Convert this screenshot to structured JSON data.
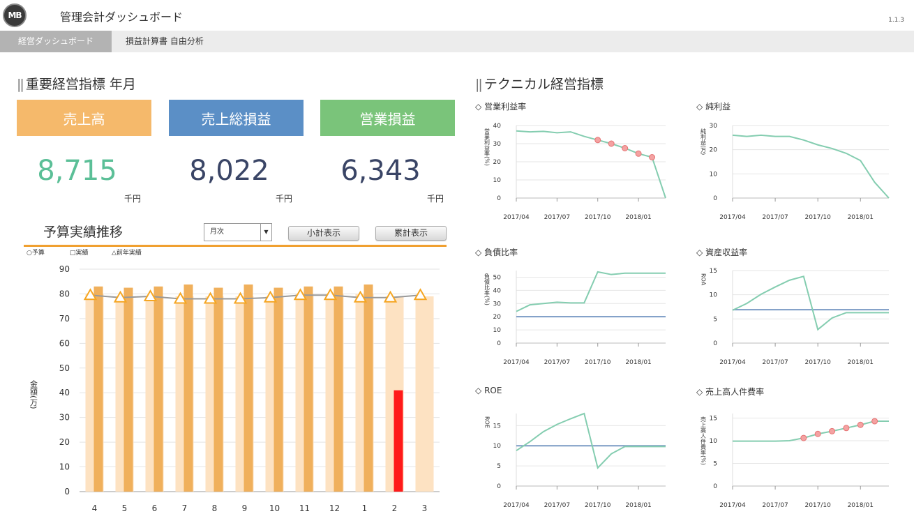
{
  "header": {
    "logo_text": "MB",
    "title": "管理会計ダッシュボード",
    "version": "1.1.3"
  },
  "nav": {
    "tabs": [
      {
        "label": "経営ダッシュボード",
        "active": true
      },
      {
        "label": "損益計算書 自由分析",
        "active": false
      }
    ]
  },
  "kpi_section": {
    "title": "重要経営指標 年月",
    "cards": [
      {
        "label": "売上高",
        "value": "8,715",
        "unit": "千円",
        "color": "#f5b96b",
        "value_color": "#5bbf97"
      },
      {
        "label": "売上総損益",
        "value": "8,022",
        "unit": "千円",
        "color": "#5b8fc6",
        "value_color": "#3a4566"
      },
      {
        "label": "営業損益",
        "value": "6,343",
        "unit": "千円",
        "color": "#7ac47a",
        "value_color": "#3a4566"
      }
    ]
  },
  "trend": {
    "title": "予算実績推移",
    "period_select": "月次",
    "subtotal_button": "小計表示",
    "cumulative_button": "累計表示",
    "legend": {
      "budget": "予算",
      "actual": "実績",
      "prev_year": "前年実績"
    },
    "ylabel": "金額(万)"
  },
  "tech_section": {
    "title": "テクニカル経営指標"
  },
  "chart_data": [
    {
      "id": "budget-actual",
      "type": "bar",
      "categories": [
        "4",
        "5",
        "6",
        "7",
        "8",
        "9",
        "10",
        "11",
        "12",
        "1",
        "2",
        "3"
      ],
      "series": [
        {
          "name": "予算",
          "values": [
            80,
            79,
            79,
            79,
            79,
            79,
            79,
            80,
            80,
            80,
            79,
            79
          ]
        },
        {
          "name": "実績",
          "values": [
            83,
            82.5,
            83,
            83.8,
            82.5,
            83.8,
            82.5,
            83,
            83,
            83.8,
            41,
            null
          ]
        },
        {
          "name": "前年実績",
          "values": [
            79.5,
            78.5,
            79,
            78,
            78,
            78,
            78.5,
            79.5,
            79.5,
            78.5,
            78.5,
            79.5
          ]
        }
      ],
      "ylabel": "金額(万)",
      "ylim": [
        0,
        90
      ],
      "yticks": [
        0,
        10,
        20,
        30,
        40,
        50,
        60,
        70,
        80,
        90
      ],
      "highlight_index": 10,
      "colors": {
        "budget": "#fde2c2",
        "actual": "#f0b05c",
        "highlight": "#ff1a1a",
        "prev": "#999999",
        "marker": "#f5a623"
      }
    },
    {
      "id": "operating-margin",
      "title": "営業利益率",
      "type": "line",
      "ylabel": "営業利益率(%)",
      "ylim": [
        0,
        40
      ],
      "yticks": [
        0,
        10,
        20,
        30,
        40
      ],
      "xticks": [
        "2017/04",
        "2017/07",
        "2017/10",
        "2018/01"
      ],
      "series": [
        {
          "values": [
            37,
            36.5,
            36.8,
            36,
            36.5,
            34,
            32,
            30,
            27.5,
            24.5,
            22.5,
            0
          ],
          "marker_from": 6
        }
      ]
    },
    {
      "id": "net-profit",
      "title": "純利益",
      "type": "line",
      "ylabel": "純利益(万)",
      "ylim": [
        0,
        30
      ],
      "yticks": [
        0,
        10,
        20,
        30
      ],
      "xticks": [
        "2017/04",
        "2017/07",
        "2017/10",
        "2018/01"
      ],
      "series": [
        {
          "values": [
            26,
            25.5,
            26,
            25.5,
            25.5,
            24,
            22,
            20.5,
            18.5,
            15.5,
            6.5,
            0
          ]
        }
      ]
    },
    {
      "id": "debt-ratio",
      "title": "負債比率",
      "type": "line",
      "ylabel": "負債比率(%)",
      "ylim": [
        0,
        55
      ],
      "yticks": [
        0,
        10,
        20,
        30,
        40,
        50
      ],
      "xticks": [
        "2017/04",
        "2017/07",
        "2017/10",
        "2018/01"
      ],
      "series": [
        {
          "values": [
            24,
            29,
            30,
            31,
            30.5,
            30.5,
            54,
            52,
            53,
            53,
            53,
            53
          ]
        }
      ],
      "reference": 20
    },
    {
      "id": "roa",
      "title": "資産収益率",
      "type": "line",
      "ylabel": "ROA",
      "ylim": [
        0,
        15
      ],
      "yticks": [
        0,
        5,
        10,
        15
      ],
      "xticks": [
        "2017/04",
        "2017/07",
        "2017/10",
        "2018/01"
      ],
      "series": [
        {
          "values": [
            6.8,
            8.2,
            10.1,
            11.6,
            13,
            13.8,
            2.8,
            5.2,
            6.3,
            6.3,
            6.3,
            6.3
          ]
        }
      ],
      "reference": 6.9
    },
    {
      "id": "roe",
      "title": "ROE",
      "type": "line",
      "ylabel": "ROE",
      "ylim": [
        0,
        18
      ],
      "yticks": [
        0,
        5,
        10,
        15
      ],
      "xticks": [
        "2017/04",
        "2017/07",
        "2017/10",
        "2018/01"
      ],
      "series": [
        {
          "values": [
            8.8,
            11,
            13.5,
            15.3,
            16.7,
            18,
            4.5,
            8,
            9.8,
            9.8,
            9.8,
            9.8
          ]
        }
      ],
      "reference": 10
    },
    {
      "id": "labor-cost-ratio",
      "title": "売上高人件費率",
      "type": "line",
      "ylabel": "売上高人件費率(%)",
      "ylim": [
        0,
        16
      ],
      "yticks": [
        0,
        5,
        10,
        15
      ],
      "xticks": [
        "2017/04",
        "2017/07",
        "2017/10",
        "2018/01"
      ],
      "series": [
        {
          "values": [
            9.9,
            9.9,
            9.9,
            9.9,
            10,
            10.6,
            11.5,
            12.1,
            12.8,
            13.5,
            14.3,
            14.3
          ],
          "marker_from": 5,
          "marker_to": 10
        }
      ]
    }
  ]
}
